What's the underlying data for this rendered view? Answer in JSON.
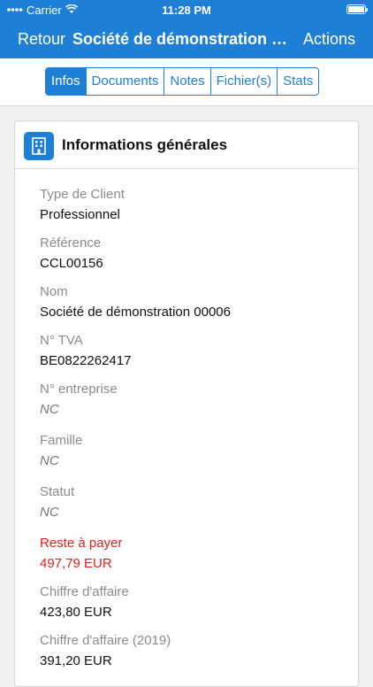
{
  "status_bar": {
    "carrier": "Carrier",
    "time": "11:28 PM"
  },
  "nav": {
    "back_label": "Retour",
    "title": "Société de démonstration 00006",
    "action_label": "Actions"
  },
  "tabs": [
    {
      "label": "Infos",
      "active": true
    },
    {
      "label": "Documents",
      "active": false
    },
    {
      "label": "Notes",
      "active": false
    },
    {
      "label": "Fichier(s)",
      "active": false
    },
    {
      "label": "Stats",
      "active": false
    }
  ],
  "card": {
    "icon": "building-icon",
    "title": "Informations générales",
    "fields": [
      {
        "label": "Type de Client",
        "value": "Professionnel"
      },
      {
        "label": "Référence",
        "value": "CCL00156"
      },
      {
        "label": "Nom",
        "value": "Société de démonstration 00006"
      },
      {
        "label": "N° TVA",
        "value": "BE0822262417"
      },
      {
        "label": "N° entreprise",
        "value": "NC"
      },
      {
        "label": "Famille",
        "value": "NC"
      },
      {
        "label": "Statut",
        "value": "NC"
      },
      {
        "label": "Reste à payer",
        "value": "497,79 EUR"
      },
      {
        "label": "Chiffre d'affaire",
        "value": "423,80 EUR"
      },
      {
        "label": "Chiffre d'affaire (2019)",
        "value": "391,20 EUR"
      }
    ]
  },
  "colors": {
    "accent": "#1e7fd6",
    "alert": "#e0201d"
  }
}
